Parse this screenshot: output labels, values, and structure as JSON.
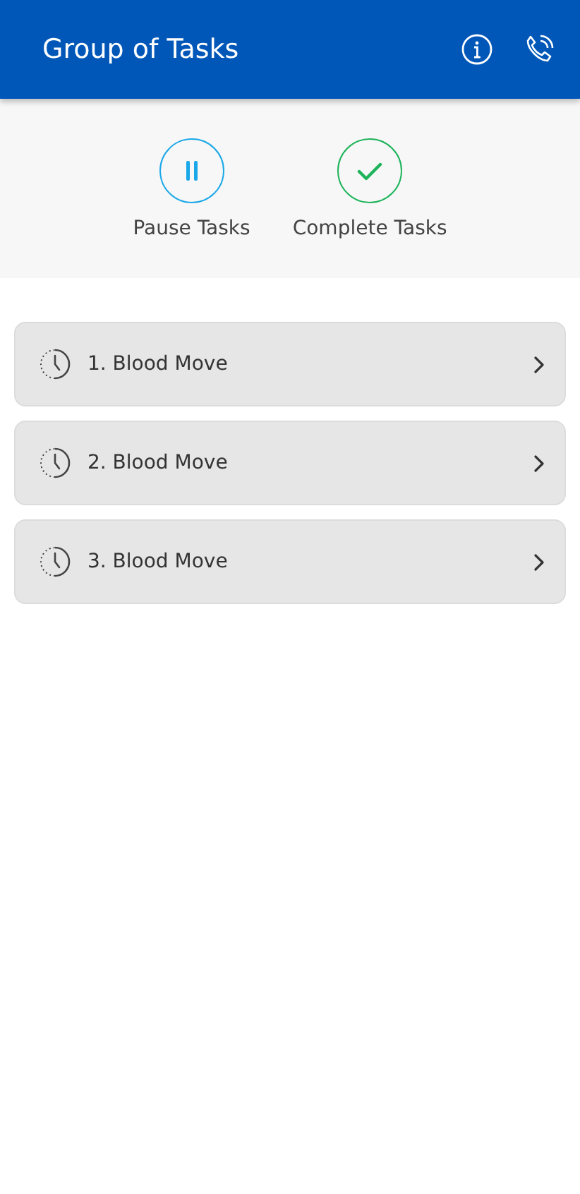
{
  "header": {
    "title": "Group of Tasks"
  },
  "actions": [
    {
      "kind": "pause",
      "label": "Pause Tasks"
    },
    {
      "kind": "complete",
      "label": "Complete Tasks"
    }
  ],
  "tasks": [
    {
      "label": "1. Blood Move"
    },
    {
      "label": "2. Blood Move"
    },
    {
      "label": "3. Blood Move"
    }
  ]
}
